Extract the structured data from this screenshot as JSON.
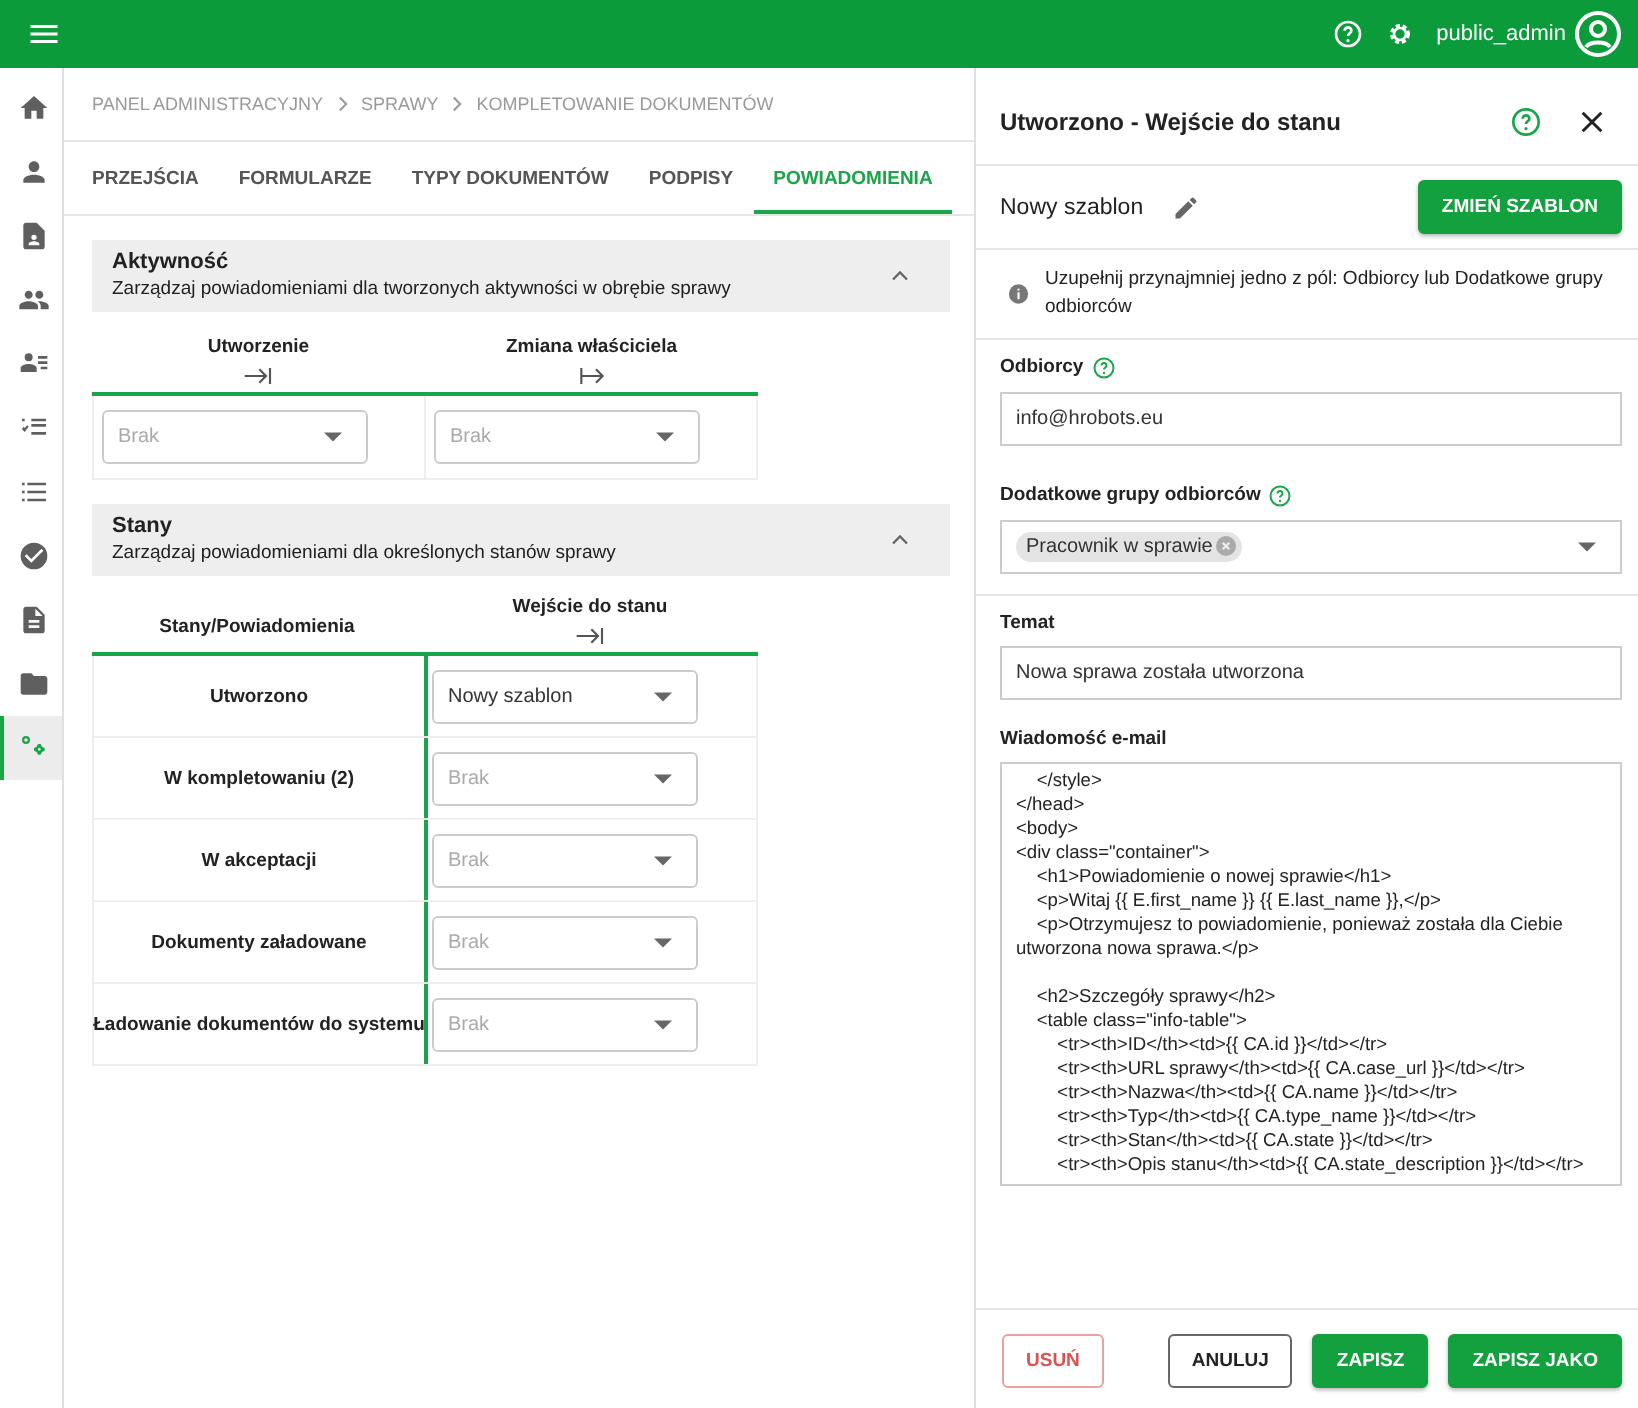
{
  "top_bar": {
    "username": "public_admin"
  },
  "sidebar": {
    "items": [
      {
        "selected": false
      },
      {
        "selected": false
      },
      {
        "selected": false
      },
      {
        "selected": false
      },
      {
        "selected": false
      },
      {
        "selected": false
      },
      {
        "selected": false
      },
      {
        "selected": false
      },
      {
        "selected": false
      },
      {
        "selected": false
      },
      {
        "selected": true
      }
    ]
  },
  "breadcrumb": [
    "PANEL ADMINISTRACYJNY",
    "SPRAWY",
    "KOMPLETOWANIE DOKUMENTÓW"
  ],
  "tabs": [
    {
      "label": "PRZEJŚCIA",
      "selected": false
    },
    {
      "label": "FORMULARZE",
      "selected": false
    },
    {
      "label": "TYPY DOKUMENTÓW",
      "selected": false
    },
    {
      "label": "PODPISY",
      "selected": false
    },
    {
      "label": "POWIADOMIENIA",
      "selected": true
    }
  ],
  "activity_section": {
    "title": "Aktywność",
    "subtitle": "Zarządzaj powiadomieniami dla tworzonych aktywności w obrębie sprawy",
    "expanded": true,
    "columns": [
      {
        "label": "Utworzenie",
        "placeholder": "Brak"
      },
      {
        "label": "Zmiana właściciela",
        "placeholder": "Brak"
      }
    ]
  },
  "states_section": {
    "title": "Stany",
    "subtitle": "Zarządzaj powiadomieniami dla określonych stanów sprawy",
    "expanded": true,
    "row_header": "Stany/Powiadomienia",
    "column": "Wejście do stanu",
    "rows": [
      {
        "label": "Utworzono",
        "value": "Nowy szablon"
      },
      {
        "label": "W kompletowaniu (2)",
        "placeholder": "Brak"
      },
      {
        "label": "W akceptacji",
        "placeholder": "Brak"
      },
      {
        "label": "Dokumenty załadowane",
        "placeholder": "Brak"
      },
      {
        "label": "Ładowanie dokumentów do systemu",
        "placeholder": "Brak"
      }
    ]
  },
  "panel": {
    "title": "Utworzono - Wejście do stanu",
    "template_name": "Nowy szablon",
    "change_button": "ZMIEŃ SZABLON",
    "info": "Uzupełnij przynajmniej jedno z pól: Odbiorcy lub Dodatkowe grupy odbiorców",
    "recipients": {
      "label": "Odbiorcy",
      "value": "info@hrobots.eu"
    },
    "groups": {
      "label": "Dodatkowe grupy odbiorców",
      "chips": [
        "Pracownik w sprawie"
      ]
    },
    "subject": {
      "label": "Temat",
      "value": "Nowa sprawa została utworzona"
    },
    "email": {
      "label": "Wiadomość e-mail",
      "value": "    </style>\n</head>\n<body>\n<div class=\"container\">\n    <h1>Powiadomienie o nowej sprawie</h1>\n    <p>Witaj {{ E.first_name }} {{ E.last_name }},</p>\n    <p>Otrzymujesz to powiadomienie, ponieważ została dla Ciebie utworzona nowa sprawa.</p>\n\n    <h2>Szczegóły sprawy</h2>\n    <table class=\"info-table\">\n        <tr><th>ID</th><td>{{ CA.id }}</td></tr>\n        <tr><th>URL sprawy</th><td>{{ CA.case_url }}</td></tr>\n        <tr><th>Nazwa</th><td>{{ CA.name }}</td></tr>\n        <tr><th>Typ</th><td>{{ CA.type_name }}</td></tr>\n        <tr><th>Stan</th><td>{{ CA.state }}</td></tr>\n        <tr><th>Opis stanu</th><td>{{ CA.state_description }}</td></tr>"
    },
    "buttons": [
      {
        "label": "USUŃ",
        "kind": "danger"
      },
      {
        "label": "ANULUJ",
        "kind": "outline"
      },
      {
        "label": "ZAPISZ",
        "kind": "primary"
      },
      {
        "label": "ZAPISZ JAKO",
        "kind": "primary"
      }
    ]
  }
}
